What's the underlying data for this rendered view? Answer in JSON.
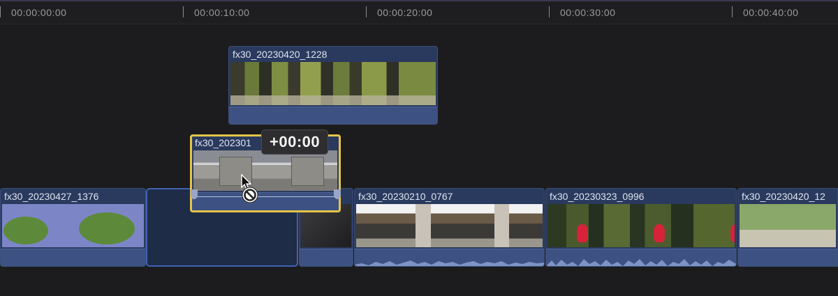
{
  "ruler": {
    "labels": [
      "00:00:00:00",
      "00:00:10:00",
      "00:00:20:00",
      "00:00:30:00",
      "00:00:40:00"
    ]
  },
  "clips": {
    "connected": {
      "name": "fx30_20230420_1228"
    },
    "dragged": {
      "name": "fx30_202301"
    },
    "c1": {
      "name": "fx30_20230427_1376"
    },
    "c3": {
      "name": "fx30_20230210_0767"
    },
    "c4": {
      "name": "fx30_20230323_0996"
    },
    "c5": {
      "name": "fx30_20230420_12"
    }
  },
  "overlay": {
    "timecode": "+00:00"
  },
  "colors": {
    "clip": "#2a3a5e",
    "selection": "#e6c448",
    "gap_outline": "#3f63b4",
    "audio": "#3d5282"
  },
  "icons": {
    "cursor": "arrow-pointer-icon",
    "no_drop": "prohibited-icon"
  }
}
